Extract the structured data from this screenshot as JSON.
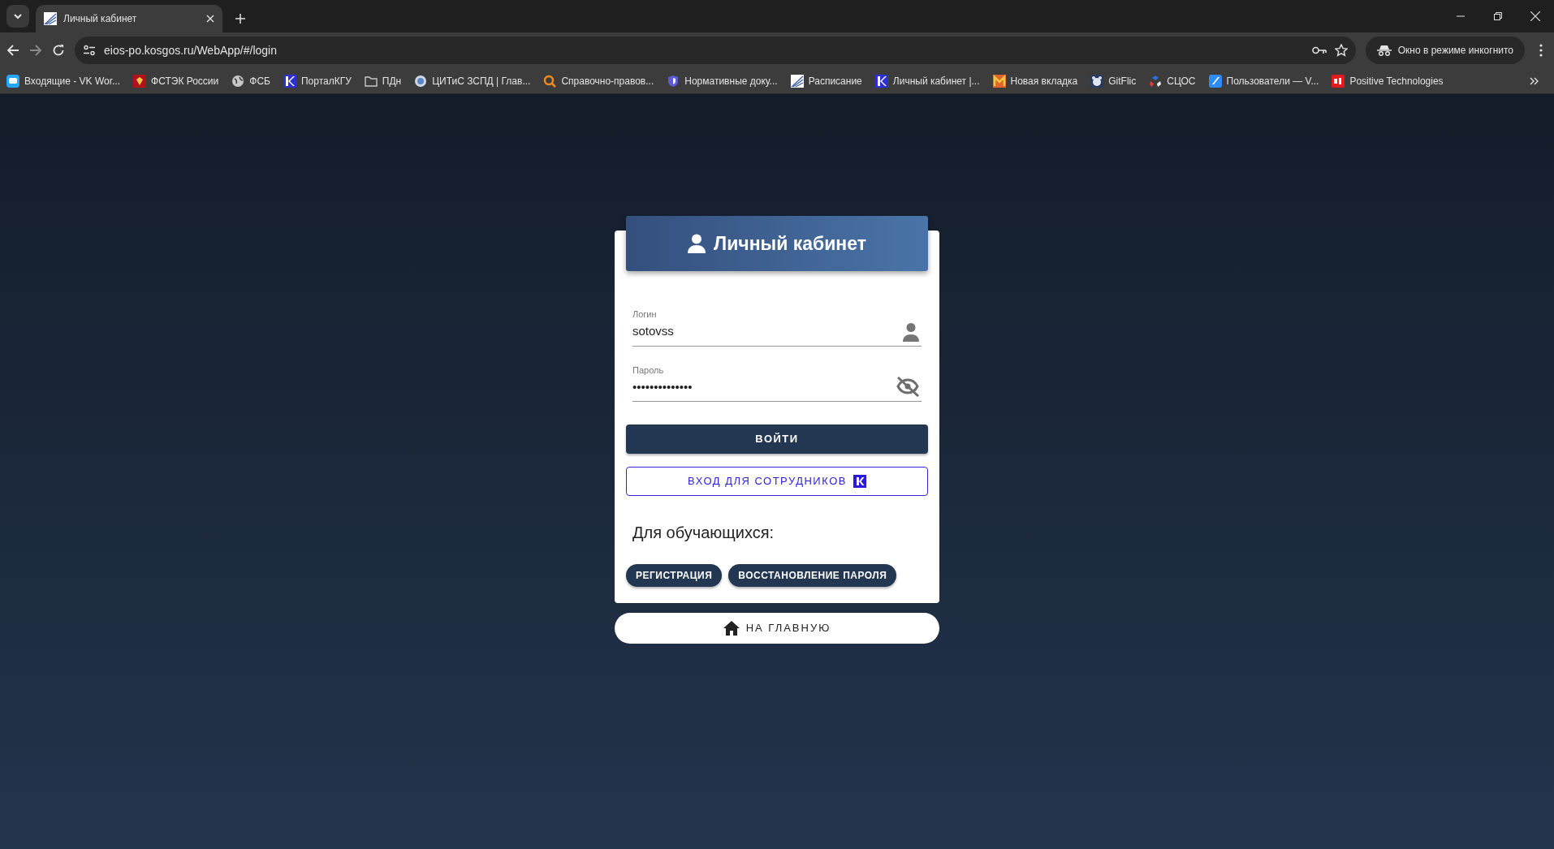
{
  "browser": {
    "tabs": [
      {
        "title": "Личный кабинет",
        "selected": true
      }
    ],
    "address": "eios-po.kosgos.ru/WebApp/#/login",
    "incognito_label": "Окно в режиме инкогнито",
    "bookmarks": [
      {
        "label": "Входящие - VK Wor..."
      },
      {
        "label": "ФСТЭК России"
      },
      {
        "label": "ФСБ"
      },
      {
        "label": "ПорталКГУ"
      },
      {
        "label": "ПДн"
      },
      {
        "label": "ЦИТиС ЗСПД | Глав..."
      },
      {
        "label": "Справочно-правов..."
      },
      {
        "label": "Нормативные доку..."
      },
      {
        "label": "Расписание"
      },
      {
        "label": "Личный кабинет |..."
      },
      {
        "label": "Новая вкладка"
      },
      {
        "label": "GitFlic"
      },
      {
        "label": "СЦОС"
      },
      {
        "label": "Пользователи — V..."
      },
      {
        "label": "Positive Technologies"
      }
    ]
  },
  "login_card": {
    "title": "Личный кабинет",
    "login": {
      "label": "Логин",
      "value": "sotovss"
    },
    "password": {
      "label": "Пароль",
      "value": "••••••••••••••"
    },
    "submit": "ВОЙТИ",
    "staff_login": "ВХОД ДЛЯ СОТРУДНИКОВ",
    "students_heading": "Для обучающихся:",
    "student_buttons": [
      "РЕГИСТРАЦИЯ",
      "ВОССТАНОВЛЕНИЕ ПАРОЛЯ"
    ]
  },
  "home_button": "НА ГЛАВНУЮ"
}
